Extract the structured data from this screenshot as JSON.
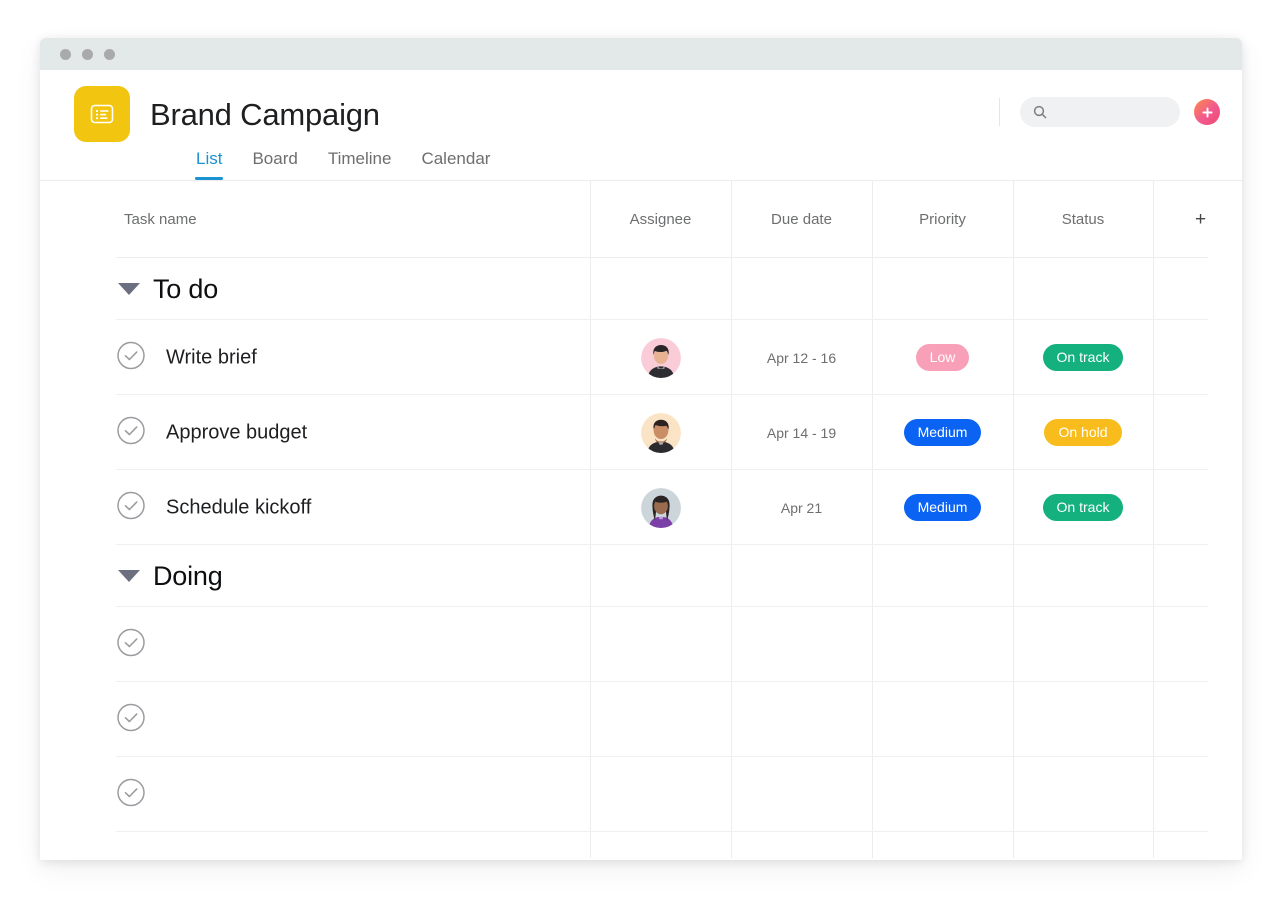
{
  "window": {
    "titlebar_dots": 3
  },
  "header": {
    "project_icon": "list-box-icon",
    "project_icon_color": "#f2c511",
    "title": "Brand Campaign",
    "search": {
      "icon": "search-icon",
      "placeholder": "",
      "value": ""
    },
    "add_button": {
      "icon": "plus-icon",
      "label": "+",
      "color_start": "#fb8b4a",
      "color_end": "#ef4a6b"
    },
    "tabs": [
      {
        "label": "List",
        "active": true
      },
      {
        "label": "Board",
        "active": false
      },
      {
        "label": "Timeline",
        "active": false
      },
      {
        "label": "Calendar",
        "active": false
      }
    ],
    "active_tab_color": "#1b92d1"
  },
  "table": {
    "columns": [
      {
        "key": "task_name",
        "label": "Task name"
      },
      {
        "key": "assignee",
        "label": "Assignee"
      },
      {
        "key": "due_date",
        "label": "Due date"
      },
      {
        "key": "priority",
        "label": "Priority"
      },
      {
        "key": "status",
        "label": "Status"
      },
      {
        "key": "add_column",
        "label": "+"
      }
    ],
    "sections": [
      {
        "name": "To do",
        "expanded": true,
        "rows": [
          {
            "task_name": "Write brief",
            "assignee": "avatar-person-1",
            "due_date": "Apr 12 - 16",
            "priority": {
              "label": "Low",
              "color": "#f8a0b8"
            },
            "status": {
              "label": "On track",
              "color": "#14b17f"
            }
          },
          {
            "task_name": "Approve budget",
            "assignee": "avatar-person-2",
            "due_date": "Apr 14 - 19",
            "priority": {
              "label": "Medium",
              "color": "#0b63f3"
            },
            "status": {
              "label": "On hold",
              "color": "#f8bd1c"
            }
          },
          {
            "task_name": "Schedule kickoff",
            "assignee": "avatar-person-3",
            "due_date": "Apr 21",
            "priority": {
              "label": "Medium",
              "color": "#0b63f3"
            },
            "status": {
              "label": "On track",
              "color": "#14b17f"
            }
          }
        ]
      },
      {
        "name": "Doing",
        "expanded": true,
        "rows": [
          {
            "task_name": "",
            "assignee": "",
            "due_date": "",
            "priority": {
              "label": "",
              "color": ""
            },
            "status": {
              "label": "",
              "color": ""
            }
          },
          {
            "task_name": "",
            "assignee": "",
            "due_date": "",
            "priority": {
              "label": "",
              "color": ""
            },
            "status": {
              "label": "",
              "color": ""
            }
          },
          {
            "task_name": "",
            "assignee": "",
            "due_date": "",
            "priority": {
              "label": "",
              "color": ""
            },
            "status": {
              "label": "",
              "color": ""
            }
          }
        ]
      }
    ]
  },
  "avatars": {
    "person1": {
      "bg": "#f9ccd8",
      "hair": "#2a2526",
      "skin": "#e7b393",
      "shirt": "#2c2c31"
    },
    "person2": {
      "bg": "#fbe3c6",
      "hair": "#2c2320",
      "skin": "#c98e66",
      "shirt": "#2b2b2f"
    },
    "person3": {
      "bg": "#ccd5da",
      "hair": "#2a2424",
      "skin": "#9a6b4f",
      "shirt": "#7b3fa8"
    }
  }
}
